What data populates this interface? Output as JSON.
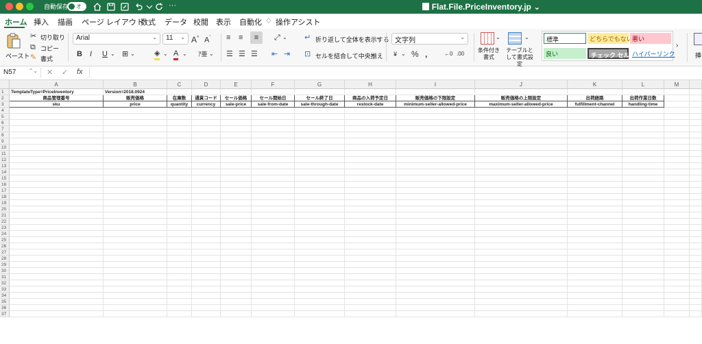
{
  "titlebar": {
    "autosave_label": "自動保存",
    "toggle_label": "オフ",
    "doc_title": "Flat.File.PriceInventory.jp"
  },
  "tabs": [
    "ホーム",
    "挿入",
    "描画",
    "ページ レイアウト",
    "数式",
    "データ",
    "校閲",
    "表示",
    "自動化",
    "操作アシスト"
  ],
  "ribbon": {
    "paste_label": "ペースト",
    "cut_label": "切り取り",
    "copy_label": "コピー",
    "format_painter_label": "書式",
    "font_name": "Arial",
    "font_size": "11",
    "wrap_text_label": "折り返して全体を表示する",
    "merge_center_label": "セルを結合して中央揃え",
    "number_format": "文字列",
    "cond_format_label": "条件付き書式",
    "table_format_label": "テーブルとして書式設定",
    "styles": {
      "normal": "標準",
      "neutral": "どちらでもない",
      "bad": "悪い",
      "good": "良い",
      "check_cell": "チェック セル",
      "hyperlink": "ハイパーリンク"
    },
    "insert_label": "挿"
  },
  "formula_bar": {
    "name_box": "N57",
    "fx_label": "fx",
    "formula": ""
  },
  "sheet": {
    "columns": [
      "A",
      "B",
      "C",
      "D",
      "E",
      "F",
      "G",
      "H",
      "I",
      "J",
      "K",
      "L",
      "M"
    ],
    "row1": {
      "a": "TemplateType=PriceInventory",
      "b": "Version=2018.0924"
    },
    "row2": [
      "商品管理番号",
      "販売価格",
      "在庫数",
      "通貨コード",
      "セール価格",
      "セール開始日",
      "セール終了日",
      "商品の入荷予定日",
      "販売価格の下限設定",
      "販売価格の上限設定",
      "出荷経路",
      "出荷作業日数"
    ],
    "row3": [
      "sku",
      "price",
      "quantity",
      "currency",
      "sale-price",
      "sale-from-date",
      "sale-through-date",
      "restock-date",
      "minimum-seller-allowed-price",
      "maximum-seller-allowed-price",
      "fulfillment-channel",
      "handling-time"
    ],
    "row_numbers": [
      "1",
      "2",
      "3",
      "4",
      "5",
      "6",
      "7",
      "8",
      "9",
      "10",
      "11",
      "12",
      "13",
      "14",
      "15",
      "16",
      "17",
      "18",
      "19",
      "20",
      "21",
      "22",
      "23",
      "24",
      "25",
      "26",
      "27",
      "28",
      "29",
      "30",
      "31",
      "32",
      "33",
      "34",
      "35",
      "36",
      "37"
    ]
  }
}
